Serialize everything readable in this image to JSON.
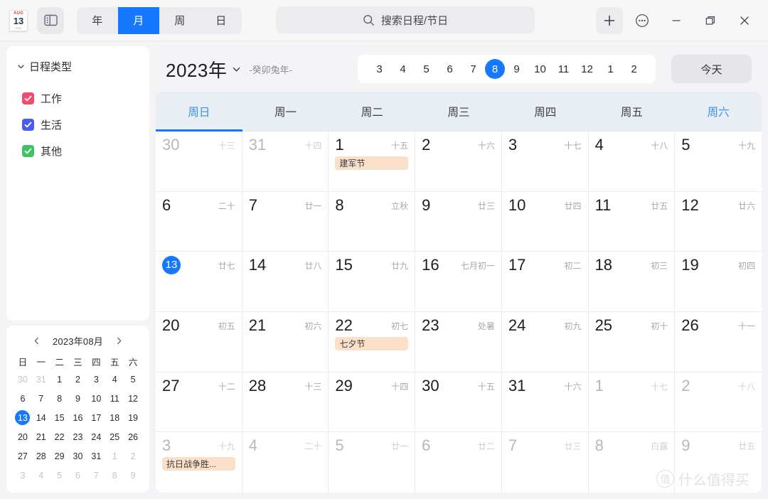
{
  "titlebar": {
    "app_icon": {
      "month": "AUG",
      "day": "13",
      "weekday": "SUN"
    },
    "panel_toggle_icon": "sidebar-panel-icon",
    "views": [
      {
        "label": "年",
        "active": false
      },
      {
        "label": "月",
        "active": true
      },
      {
        "label": "周",
        "active": false
      },
      {
        "label": "日",
        "active": false
      }
    ],
    "search": {
      "placeholder": "搜索日程/节日",
      "icon": "search-icon"
    },
    "add_label": "+",
    "more_label": "⋯",
    "minimize_label": "—",
    "restore_label": "❐",
    "close_label": "✕"
  },
  "sidebar": {
    "types_header": "日程类型",
    "types": [
      {
        "label": "工作",
        "color": "#f24a70"
      },
      {
        "label": "生活",
        "color": "#4a5cf2"
      },
      {
        "label": "其他",
        "color": "#3fc463"
      }
    ],
    "mini_calendar": {
      "title": "2023年08月",
      "prev_icon": "chevron-left-icon",
      "next_icon": "chevron-right-icon",
      "weekdays": [
        "日",
        "一",
        "二",
        "三",
        "四",
        "五",
        "六"
      ],
      "weeks": [
        [
          {
            "d": "30",
            "out": true
          },
          {
            "d": "31",
            "out": true
          },
          {
            "d": "1"
          },
          {
            "d": "2"
          },
          {
            "d": "3"
          },
          {
            "d": "4"
          },
          {
            "d": "5"
          }
        ],
        [
          {
            "d": "6"
          },
          {
            "d": "7"
          },
          {
            "d": "8"
          },
          {
            "d": "9"
          },
          {
            "d": "10"
          },
          {
            "d": "11"
          },
          {
            "d": "12"
          }
        ],
        [
          {
            "d": "13",
            "today": true
          },
          {
            "d": "14"
          },
          {
            "d": "15"
          },
          {
            "d": "16"
          },
          {
            "d": "17"
          },
          {
            "d": "18"
          },
          {
            "d": "19"
          }
        ],
        [
          {
            "d": "20"
          },
          {
            "d": "21"
          },
          {
            "d": "22"
          },
          {
            "d": "23"
          },
          {
            "d": "24"
          },
          {
            "d": "25"
          },
          {
            "d": "26"
          }
        ],
        [
          {
            "d": "27"
          },
          {
            "d": "28"
          },
          {
            "d": "29"
          },
          {
            "d": "30"
          },
          {
            "d": "31"
          },
          {
            "d": "1",
            "out": true
          },
          {
            "d": "2",
            "out": true
          }
        ],
        [
          {
            "d": "3",
            "out": true
          },
          {
            "d": "4",
            "out": true
          },
          {
            "d": "5",
            "out": true
          },
          {
            "d": "6",
            "out": true
          },
          {
            "d": "7",
            "out": true
          },
          {
            "d": "8",
            "out": true
          },
          {
            "d": "9",
            "out": true
          }
        ]
      ]
    }
  },
  "main": {
    "year_label": "2023年",
    "year_chevron_icon": "chevron-down-icon",
    "zodiac_label": "-癸卯兔年-",
    "months": [
      {
        "label": "3",
        "active": false
      },
      {
        "label": "4",
        "active": false
      },
      {
        "label": "5",
        "active": false
      },
      {
        "label": "6",
        "active": false
      },
      {
        "label": "7",
        "active": false
      },
      {
        "label": "8",
        "active": true
      },
      {
        "label": "9",
        "active": false
      },
      {
        "label": "10",
        "active": false
      },
      {
        "label": "11",
        "active": false
      },
      {
        "label": "12",
        "active": false
      },
      {
        "label": "1",
        "active": false
      },
      {
        "label": "2",
        "active": false
      }
    ],
    "today_button": "今天",
    "weekday_headers": [
      {
        "label": "周日",
        "weekend": true,
        "selected": true
      },
      {
        "label": "周一",
        "weekend": false,
        "selected": false
      },
      {
        "label": "周二",
        "weekend": false,
        "selected": false
      },
      {
        "label": "周三",
        "weekend": false,
        "selected": false
      },
      {
        "label": "周四",
        "weekend": false,
        "selected": false
      },
      {
        "label": "周五",
        "weekend": false,
        "selected": false
      },
      {
        "label": "周六",
        "weekend": true,
        "selected": false
      }
    ],
    "weeks": [
      [
        {
          "day": "30",
          "lunar": "十三",
          "out": true
        },
        {
          "day": "31",
          "lunar": "十四",
          "out": true
        },
        {
          "day": "1",
          "lunar": "十五",
          "event": "建军节"
        },
        {
          "day": "2",
          "lunar": "十六"
        },
        {
          "day": "3",
          "lunar": "十七"
        },
        {
          "day": "4",
          "lunar": "十八"
        },
        {
          "day": "5",
          "lunar": "十九"
        }
      ],
      [
        {
          "day": "6",
          "lunar": "二十"
        },
        {
          "day": "7",
          "lunar": "廿一"
        },
        {
          "day": "8",
          "lunar": "立秋"
        },
        {
          "day": "9",
          "lunar": "廿三"
        },
        {
          "day": "10",
          "lunar": "廿四"
        },
        {
          "day": "11",
          "lunar": "廿五"
        },
        {
          "day": "12",
          "lunar": "廿六"
        }
      ],
      [
        {
          "day": "13",
          "lunar": "廿七",
          "today": true
        },
        {
          "day": "14",
          "lunar": "廿八"
        },
        {
          "day": "15",
          "lunar": "廿九"
        },
        {
          "day": "16",
          "lunar": "七月初一"
        },
        {
          "day": "17",
          "lunar": "初二"
        },
        {
          "day": "18",
          "lunar": "初三"
        },
        {
          "day": "19",
          "lunar": "初四"
        }
      ],
      [
        {
          "day": "20",
          "lunar": "初五"
        },
        {
          "day": "21",
          "lunar": "初六"
        },
        {
          "day": "22",
          "lunar": "初七",
          "event": "七夕节"
        },
        {
          "day": "23",
          "lunar": "处暑"
        },
        {
          "day": "24",
          "lunar": "初九"
        },
        {
          "day": "25",
          "lunar": "初十"
        },
        {
          "day": "26",
          "lunar": "十一"
        }
      ],
      [
        {
          "day": "27",
          "lunar": "十二"
        },
        {
          "day": "28",
          "lunar": "十三"
        },
        {
          "day": "29",
          "lunar": "十四"
        },
        {
          "day": "30",
          "lunar": "十五"
        },
        {
          "day": "31",
          "lunar": "十六"
        },
        {
          "day": "1",
          "lunar": "十七",
          "out": true
        },
        {
          "day": "2",
          "lunar": "十八",
          "out": true
        }
      ],
      [
        {
          "day": "3",
          "lunar": "十九",
          "out": true,
          "event": "抗日战争胜..."
        },
        {
          "day": "4",
          "lunar": "二十",
          "out": true
        },
        {
          "day": "5",
          "lunar": "廿一",
          "out": true
        },
        {
          "day": "6",
          "lunar": "廿二",
          "out": true
        },
        {
          "day": "7",
          "lunar": "廿三",
          "out": true
        },
        {
          "day": "8",
          "lunar": "白露",
          "out": true
        },
        {
          "day": "9",
          "lunar": "廿五",
          "out": true
        }
      ]
    ]
  },
  "watermark": {
    "mark": "值",
    "text": "什么值得买"
  },
  "colors": {
    "accent": "#1677ff",
    "event_chip_bg": "#fadfc9",
    "weekday_header_bg": "#e8eef4",
    "window_bg": "#f4f4f6"
  }
}
